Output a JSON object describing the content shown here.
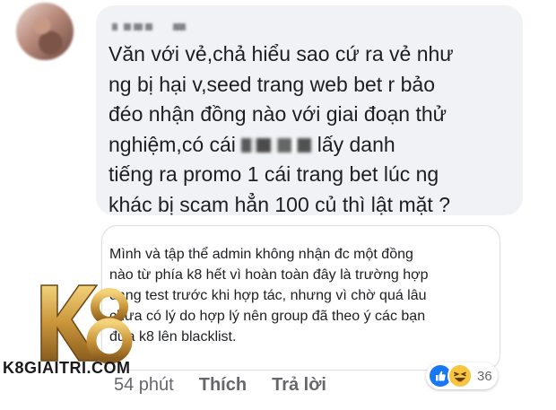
{
  "comment": {
    "author_blurred": true,
    "text_lines": [
      "Văn với vẻ,chả hiểu sao cứ ra vẻ như",
      "ng bị hại v,seed trang web bet r bảo",
      "đéo nhận đồng nào với giai đoạn thử",
      "nghiệm,có cái ",
      " lấy danh",
      "tiếng ra promo 1 cái trang bet lúc ng",
      "khác bị scam hẳn 100 củ thì lật mặt ?"
    ]
  },
  "reply": {
    "text_lines": [
      "Mình và tập thể admin không nhận đc một đồng",
      "nào từ phía k8 hết vì hoàn toàn đây là trường hợp",
      "đang test trước khi hợp tác, nhưng vì chờ quá lâu",
      "chưa có lý do hợp lý nên group đã theo ý các bạn",
      "đưa k8 lên blacklist."
    ]
  },
  "reactions": {
    "count": "36",
    "icons": [
      "like-icon",
      "haha-icon"
    ],
    "colors": {
      "like": "#1877f2",
      "haha": "#f7c53f"
    }
  },
  "actions": {
    "time": "54 phút",
    "like": "Thích",
    "reply": "Trả lời"
  },
  "watermark": {
    "logo_text": "K8",
    "site": "K8GIAITRI.COM",
    "colors": {
      "gold": "#c9953a",
      "text": "#1a1a1a"
    }
  }
}
